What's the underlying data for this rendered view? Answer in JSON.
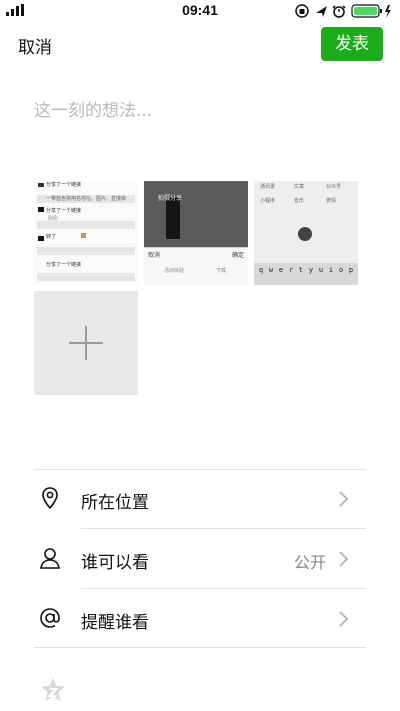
{
  "status_bar": {
    "time": "09:41",
    "icons": [
      "signal-icon",
      "rotation-lock-icon",
      "location-icon",
      "alarm-icon",
      "battery-charging-icon"
    ],
    "battery_color": "#4cd964"
  },
  "nav": {
    "cancel_label": "取消",
    "publish_label": "发表",
    "publish_color": "#1aad19"
  },
  "composer": {
    "placeholder": "这一刻的想法..."
  },
  "attachments": {
    "thumb1": {
      "rows": [
        "分享了一个链接",
        "分享了一个链接",
        "刚刚",
        "转了",
        "分享了一个链接"
      ],
      "subtext": "一带蓝色常用名地址、图片、直接库"
    },
    "thumb2": {
      "caption": "拍摄分享",
      "cancel": "取消",
      "confirm": "确定",
      "footer1": "活动体验",
      "footer2": "下载"
    },
    "thumb3": {
      "top_labels": [
        "通讯录",
        "文章",
        "公众号"
      ],
      "mid_labels": [
        "小程序",
        "音乐",
        "表情"
      ],
      "keys": [
        "q",
        "w",
        "e",
        "r",
        "t",
        "y",
        "u",
        "i",
        "o",
        "p"
      ]
    },
    "add_icon": "plus-icon"
  },
  "options": [
    {
      "icon": "location-pin-icon",
      "label": "所在位置",
      "value": ""
    },
    {
      "icon": "person-icon",
      "label": "谁可以看",
      "value": "公开"
    },
    {
      "icon": "at-sign-icon",
      "label": "提醒谁看",
      "value": ""
    }
  ],
  "bottom": {
    "icon": "zone-icon"
  }
}
